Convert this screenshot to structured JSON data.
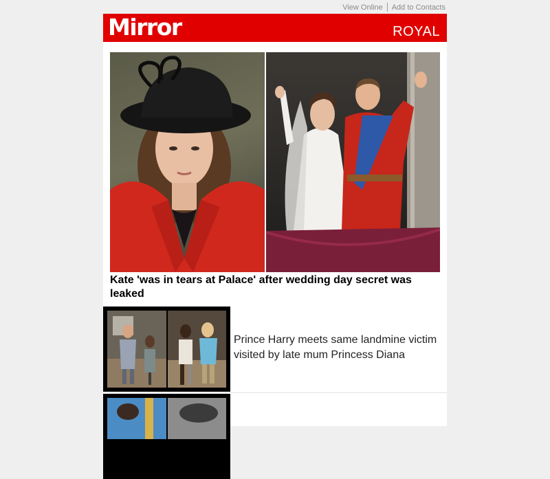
{
  "topbar": {
    "view_online": "View Online",
    "add_to_contacts": "Add to Contacts"
  },
  "header": {
    "logo": "Mirror",
    "section": "ROYAL",
    "brand_color": "#e00000"
  },
  "lead_story": {
    "headline": "Kate 'was in tears at Palace' after wedding day secret was leaked"
  },
  "stories": [
    {
      "title": "Prince Harry meets same landmine victim visited by late mum Princess Diana"
    },
    {
      "title": ""
    }
  ]
}
